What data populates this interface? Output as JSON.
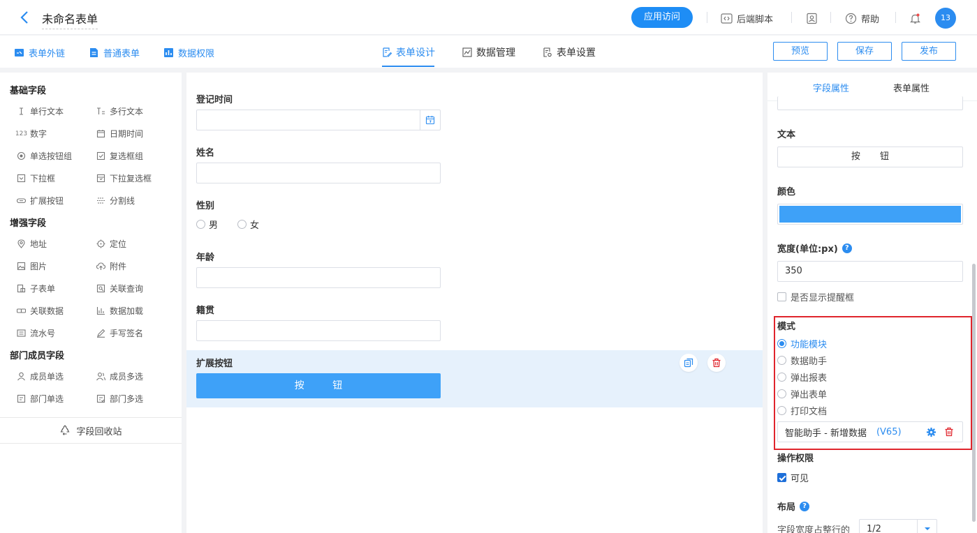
{
  "header": {
    "title": "未命名表单",
    "app_visit": "应用访问",
    "backend_script": "后端脚本",
    "help": "帮助",
    "avatar": "13"
  },
  "subbar": {
    "external_link": "表单外链",
    "normal_form": "普通表单",
    "data_permission": "数据权限",
    "tabs": [
      "表单设计",
      "数据管理",
      "表单设置"
    ],
    "active_tab": "表单设计",
    "preview": "预览",
    "save": "保存",
    "publish": "发布"
  },
  "palette": {
    "basic_title": "基础字段",
    "basic": [
      {
        "label": "单行文本",
        "icon": "text-cursor-icon"
      },
      {
        "label": "多行文本",
        "icon": "multiline-text-icon"
      },
      {
        "label": "数字",
        "icon": "number-icon"
      },
      {
        "label": "日期时间",
        "icon": "calendar-icon"
      },
      {
        "label": "单选按钮组",
        "icon": "radio-icon"
      },
      {
        "label": "复选框组",
        "icon": "checkbox-icon"
      },
      {
        "label": "下拉框",
        "icon": "dropdown-icon"
      },
      {
        "label": "下拉复选框",
        "icon": "dropdown-check-icon"
      },
      {
        "label": "扩展按钮",
        "icon": "button-icon"
      },
      {
        "label": "分割线",
        "icon": "divider-icon"
      }
    ],
    "enhanced_title": "增强字段",
    "enhanced": [
      {
        "label": "地址",
        "icon": "location-pin-icon"
      },
      {
        "label": "定位",
        "icon": "crosshair-icon"
      },
      {
        "label": "图片",
        "icon": "image-icon"
      },
      {
        "label": "附件",
        "icon": "cloud-upload-icon"
      },
      {
        "label": "子表单",
        "icon": "subform-icon"
      },
      {
        "label": "关联查询",
        "icon": "link-query-icon"
      },
      {
        "label": "关联数据",
        "icon": "link-data-icon"
      },
      {
        "label": "数据加载",
        "icon": "bar-chart-icon"
      },
      {
        "label": "流水号",
        "icon": "serial-icon"
      },
      {
        "label": "手写签名",
        "icon": "pen-icon"
      }
    ],
    "member_title": "部门成员字段",
    "member": [
      {
        "label": "成员单选",
        "icon": "user-icon"
      },
      {
        "label": "成员多选",
        "icon": "users-icon"
      },
      {
        "label": "部门单选",
        "icon": "dept-icon"
      },
      {
        "label": "部门多选",
        "icon": "dept-multi-icon"
      }
    ],
    "recycle": "字段回收站"
  },
  "canvas": {
    "fields": [
      {
        "label": "登记时间"
      },
      {
        "label": "姓名"
      },
      {
        "label": "性别",
        "options": [
          "男",
          "女"
        ]
      },
      {
        "label": "年龄"
      },
      {
        "label": "籍贯"
      }
    ],
    "extension": {
      "label": "扩展按钮",
      "button_text": "按 钮"
    }
  },
  "props": {
    "tabs": [
      "字段属性",
      "表单属性"
    ],
    "active_tab": "字段属性",
    "text_label": "文本",
    "text_value": "按 钮",
    "color_label": "颜色",
    "color_value": "#3ea1f8",
    "width_label": "宽度(单位:px)",
    "width_value": "350",
    "show_tip_label": "是否显示提醒框",
    "mode_label": "模式",
    "modes": [
      "功能模块",
      "数据助手",
      "弹出报表",
      "弹出表单",
      "打印文档"
    ],
    "selected_mode": "功能模块",
    "assistant_text": "智能助手 - 新增数据",
    "assistant_version": "(V65)",
    "permission_label": "操作权限",
    "visible_label": "可见",
    "layout_label": "布局",
    "width_ratio_label": "字段宽度占整行的",
    "width_ratio_value": "1/2"
  }
}
